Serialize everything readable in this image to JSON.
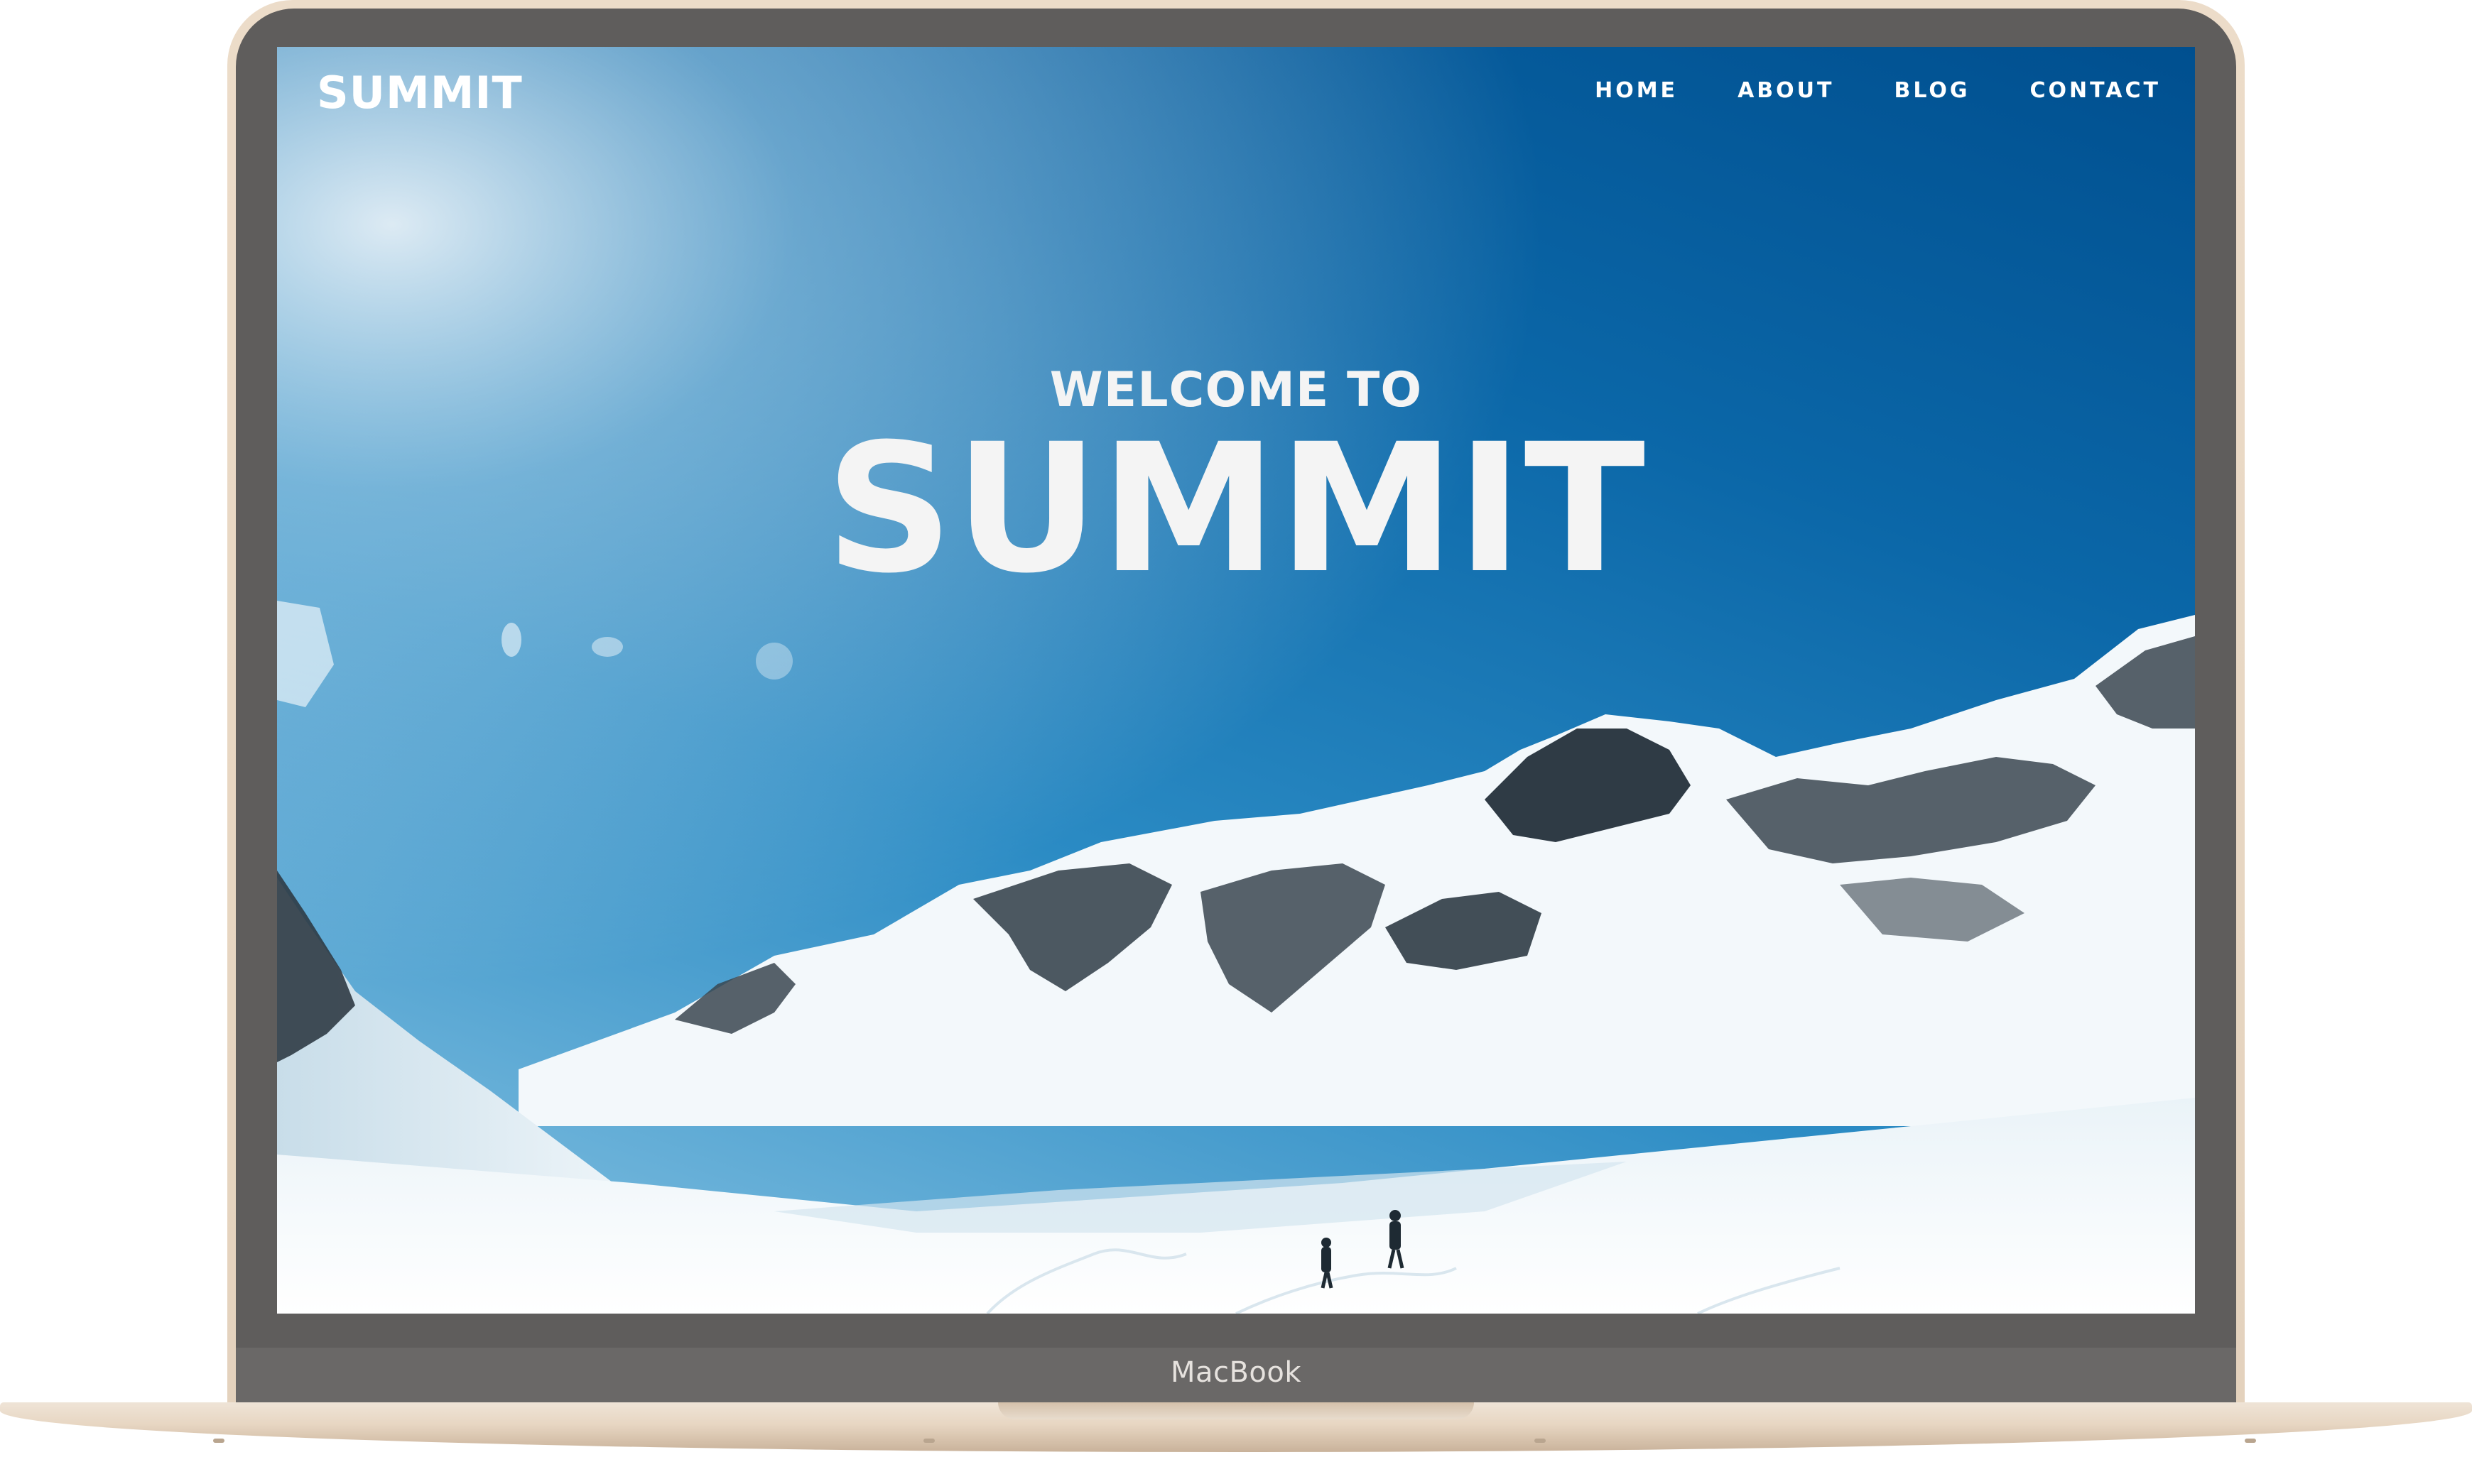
{
  "site": {
    "logo": "SUMMIT",
    "nav": [
      {
        "label": "HOME"
      },
      {
        "label": "ABOUT"
      },
      {
        "label": "BLOG"
      },
      {
        "label": "CONTACT"
      }
    ],
    "hero": {
      "subtitle": "WELCOME TO",
      "title": "SUMMIT"
    }
  },
  "device": {
    "label": "MacBook"
  },
  "colors": {
    "sky_top": "#00508f",
    "sky_bottom": "#8cc6e4",
    "snow": "#f3f8fb",
    "rock": "#3a4650",
    "bezel": "#5f5d5c",
    "chassis": "#ecdcc9",
    "text": "#ffffff"
  }
}
